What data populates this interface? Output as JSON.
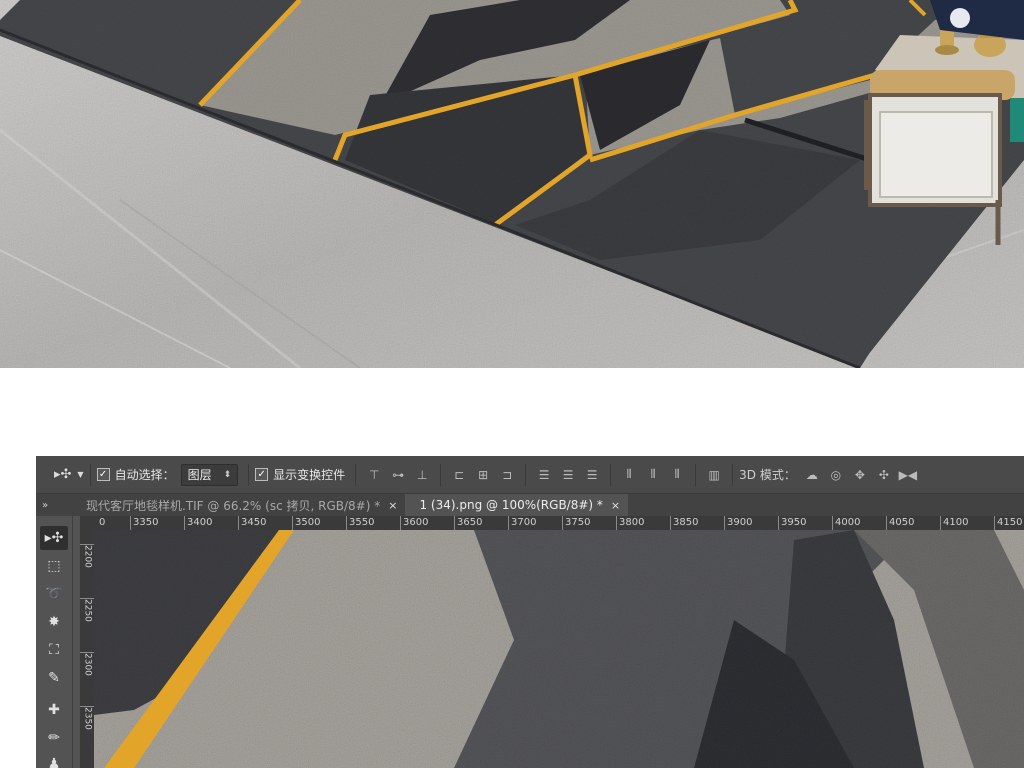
{
  "options_bar": {
    "move_tool_icon": "move-tool-icon",
    "auto_select_label": "自动选择：",
    "auto_select_checked": true,
    "layer_select_value": "图层",
    "show_transform_label": "显示变换控件",
    "show_transform_checked": true,
    "mode_3d_label": "3D 模式："
  },
  "tabs": [
    {
      "label": "现代客厅地毯样机.TIF @ 66.2% (sc 拷贝, RGB/8#) *",
      "active": false,
      "close": "×"
    },
    {
      "label": "1 (34).png @ 100%(RGB/8#) *",
      "active": true,
      "close": "×"
    }
  ],
  "ruler": {
    "horizontal": [
      "0",
      "3350",
      "3400",
      "3450",
      "3500",
      "3550",
      "3600",
      "3650",
      "3700",
      "3750",
      "3800",
      "3850",
      "3900",
      "3950",
      "4000",
      "4050",
      "4100",
      "4150"
    ],
    "vertical": [
      "2200",
      "2250",
      "2300",
      "2350"
    ]
  },
  "tools": [
    "move-tool-icon",
    "marquee-tool-icon",
    "lasso-tool-icon",
    "magic-wand-icon",
    "crop-tool-icon",
    "eyedropper-icon",
    "healing-brush-icon",
    "brush-tool-icon",
    "stamp-tool-icon"
  ],
  "colors": {
    "gold_stripe": "#e2a52a",
    "rug_dark": "#47484c",
    "rug_light": "#9b9791",
    "ui_panel": "#535353"
  }
}
